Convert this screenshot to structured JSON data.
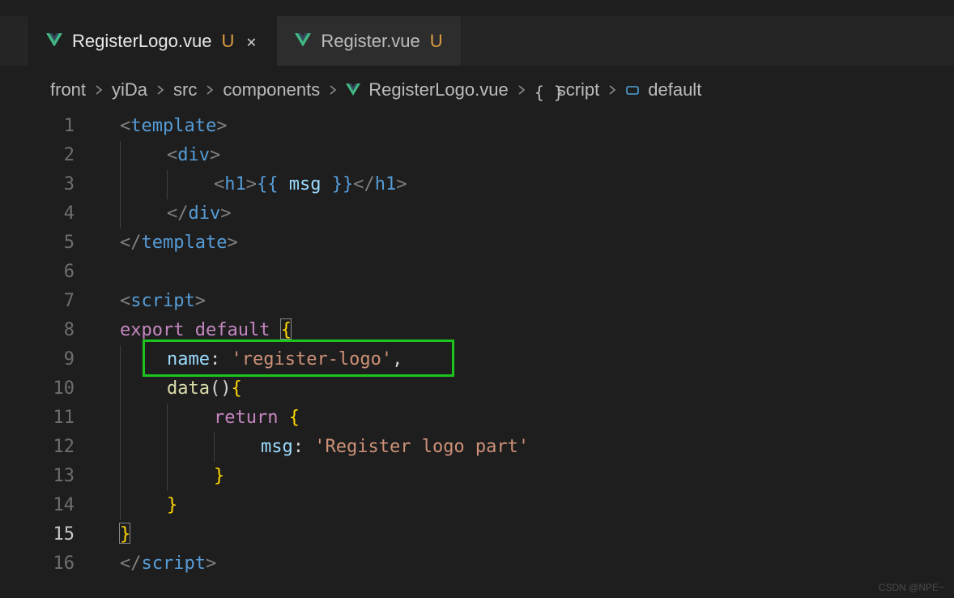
{
  "tabs": [
    {
      "filename": "RegisterLogo.vue",
      "status": "U",
      "active": true,
      "closeable": true
    },
    {
      "filename": "Register.vue",
      "status": "U",
      "active": false,
      "closeable": false
    }
  ],
  "breadcrumbs": {
    "items": [
      {
        "label": "front",
        "icon": null
      },
      {
        "label": "yiDa",
        "icon": null
      },
      {
        "label": "src",
        "icon": null
      },
      {
        "label": "components",
        "icon": null
      },
      {
        "label": "RegisterLogo.vue",
        "icon": "vue"
      },
      {
        "label": "script",
        "icon": "braces"
      },
      {
        "label": "default",
        "icon": "cube"
      }
    ]
  },
  "lines": {
    "1": "<template>",
    "2": "    <div>",
    "3": "        <h1>{{ msg }}</h1>",
    "4": "    </div>",
    "5": "</template>",
    "6": "",
    "7": "<script>",
    "8": "export default {",
    "9": "    name: 'register-logo',",
    "10": "    data(){",
    "11": "        return {",
    "12": "            msg: 'Register logo part'",
    "13": "        }",
    "14": "    }",
    "15": "}",
    "16": "</script>"
  },
  "tokens": {
    "tag_template": "template",
    "tag_div": "div",
    "tag_h1": "h1",
    "tag_script": "script",
    "interp_var": "msg",
    "kw_export": "export",
    "kw_default": "default",
    "kw_return": "return",
    "prop_name": "name",
    "prop_msg": "msg",
    "fn_data": "data",
    "str_register_logo": "'register-logo'",
    "str_msg_value": "'Register logo part'"
  },
  "status_letter": "U",
  "watermark": "CSDN @NPE~",
  "colors": {
    "bg": "#1e1e1e",
    "tab_bg": "#252526",
    "vue_green": "#41b883",
    "status_orange": "#db9b3f",
    "highlight_green": "#1ec41e"
  }
}
